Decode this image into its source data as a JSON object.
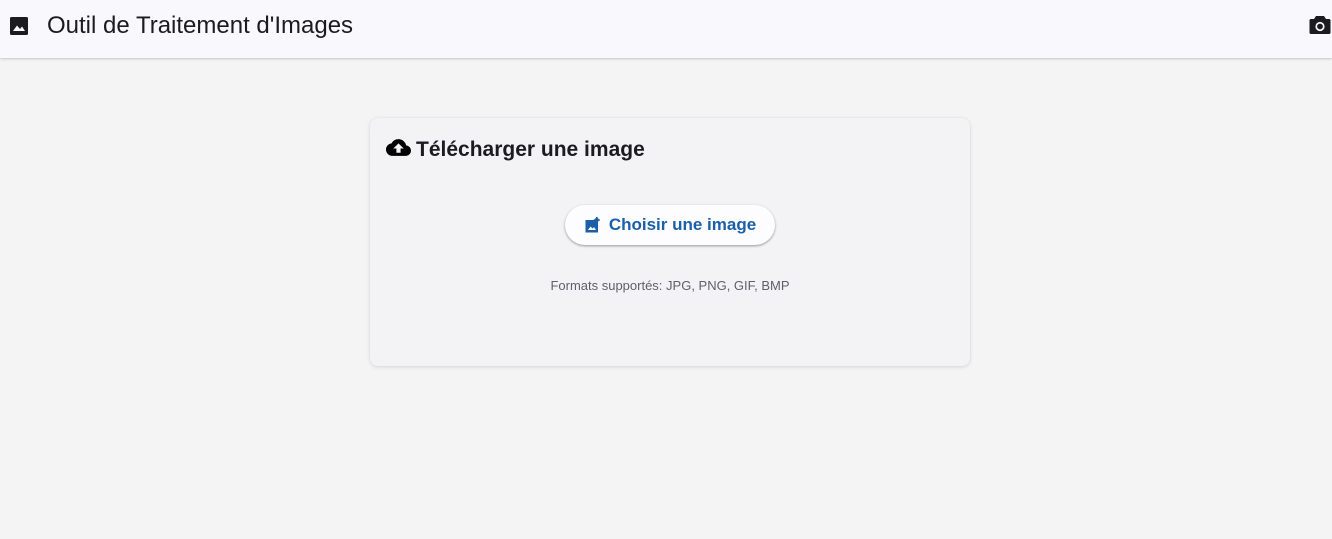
{
  "app_bar": {
    "title": "Outil de Traitement d'Images",
    "logo_icon": "image-icon",
    "action_icon": "camera-icon"
  },
  "upload_card": {
    "header_icon": "cloud-upload-icon",
    "title": "Télécharger une image",
    "choose_button": {
      "icon": "add-photo-icon",
      "label": "Choisir une image"
    },
    "formats_text": "Formats supportés: JPG, PNG, GIF, BMP"
  },
  "colors": {
    "page_background": "#f4f4f5",
    "app_bar_background": "#f9f8fd",
    "card_background": "#f3f3f6",
    "accent": "#1a5fa8",
    "text_primary": "#1c1b1f",
    "text_secondary": "#5f5f66"
  }
}
